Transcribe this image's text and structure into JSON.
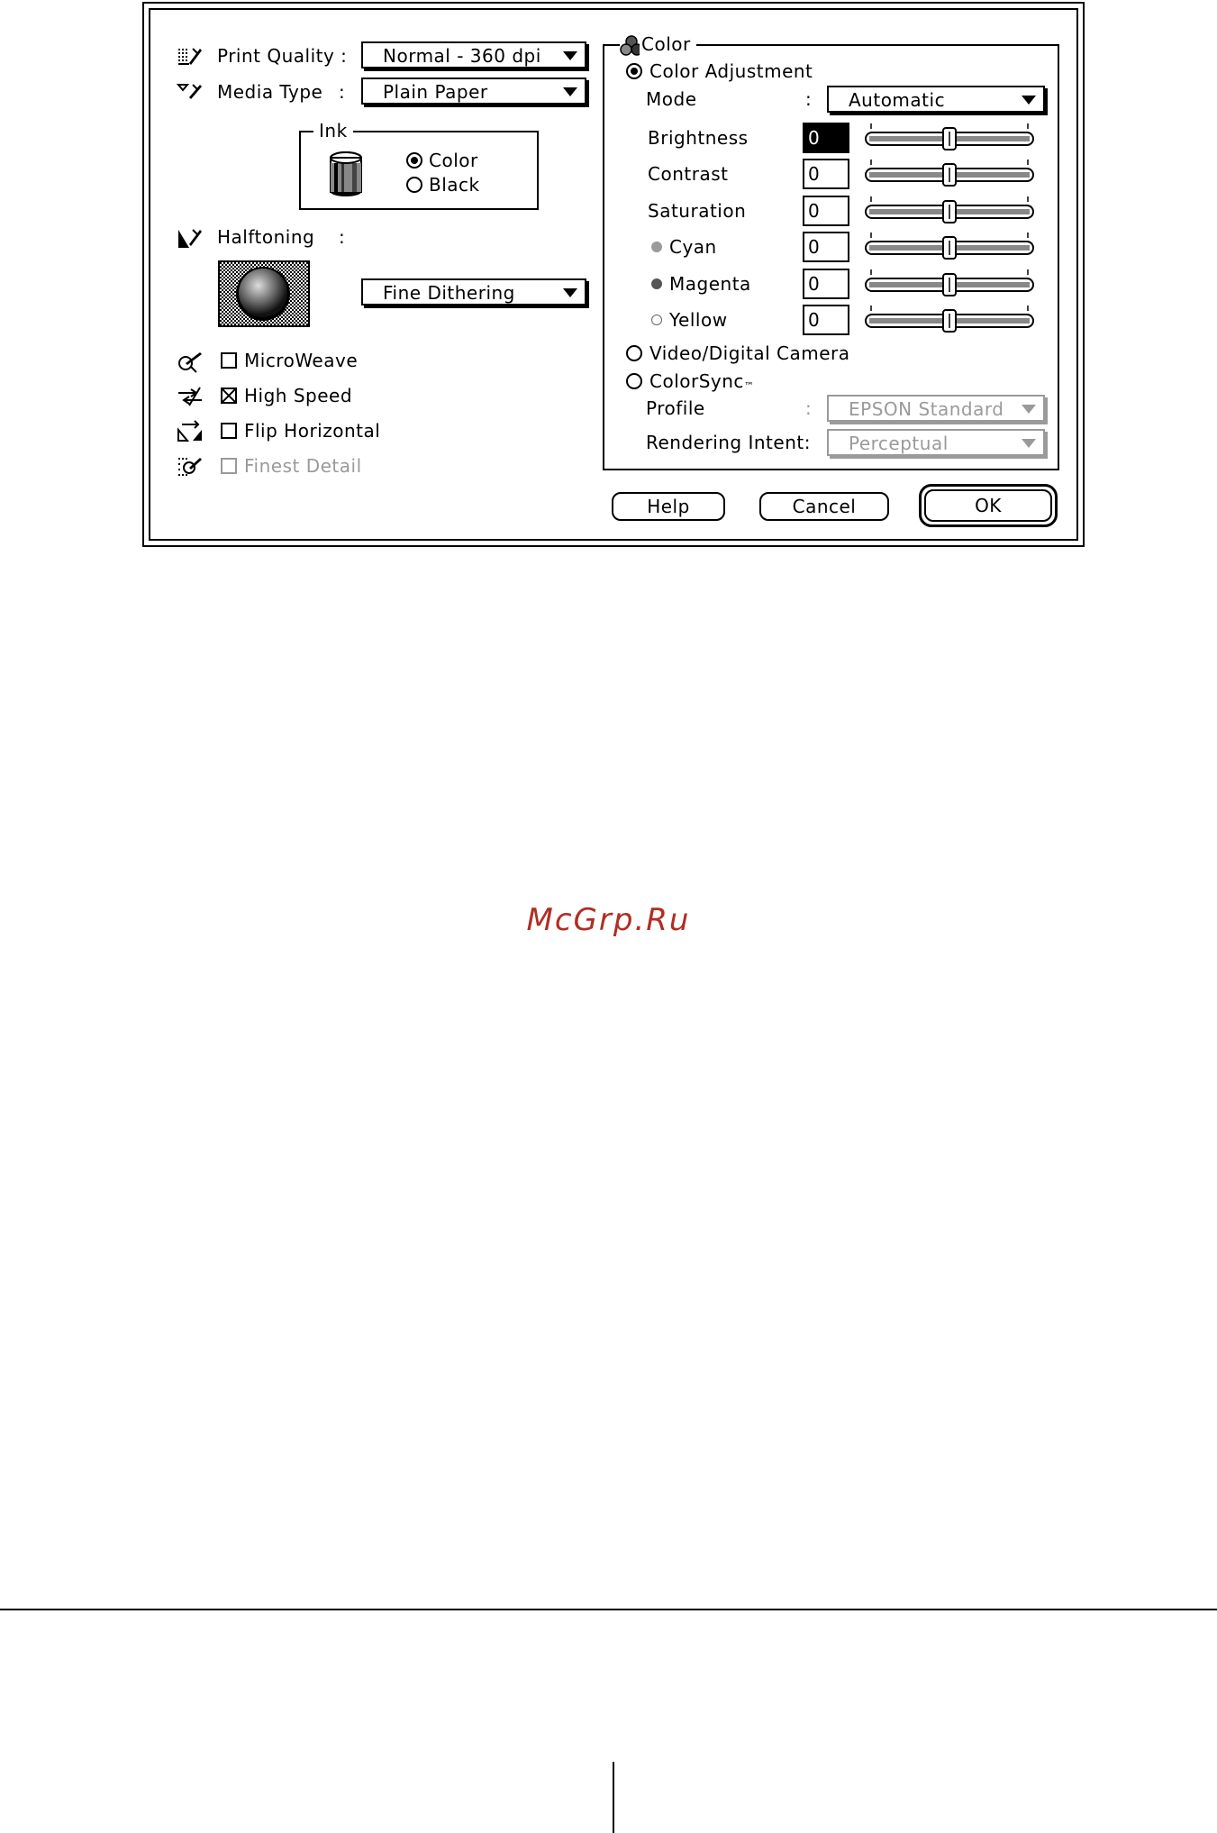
{
  "dialog": {
    "print_quality": {
      "label": "Print Quality :",
      "value": "Normal - 360 dpi",
      "icon": "print-quality-icon"
    },
    "media_type": {
      "label": "Media Type",
      "colon": ":",
      "value": "Plain Paper",
      "icon": "media-type-icon"
    },
    "ink": {
      "title": "Ink",
      "icon": "ink-cartridge-icon",
      "options": [
        {
          "label": "Color",
          "selected": true
        },
        {
          "label": "Black",
          "selected": false
        }
      ]
    },
    "halftoning": {
      "label": "Halftoning",
      "colon": ":",
      "value": "Fine Dithering",
      "icon": "halftoning-icon"
    },
    "checkboxes": [
      {
        "label": "MicroWeave",
        "checked": false,
        "enabled": true,
        "icon": "microweave-icon"
      },
      {
        "label": "High Speed",
        "checked": true,
        "enabled": true,
        "icon": "high-speed-icon"
      },
      {
        "label": "Flip Horizontal",
        "checked": false,
        "enabled": true,
        "icon": "flip-horizontal-icon"
      },
      {
        "label": "Finest Detail",
        "checked": false,
        "enabled": false,
        "icon": "finest-detail-icon"
      }
    ],
    "color": {
      "title": "Color",
      "color_adjustment": {
        "label": "Color Adjustment",
        "selected": true
      },
      "mode": {
        "label": "Mode",
        "colon": ":",
        "value": "Automatic"
      },
      "sliders": [
        {
          "label": "Brightness",
          "value": "0",
          "dot": ""
        },
        {
          "label": "Contrast",
          "value": "0",
          "dot": ""
        },
        {
          "label": "Saturation",
          "value": "0",
          "dot": ""
        },
        {
          "label": "Cyan",
          "value": "0",
          "dot": "#9a9a9a"
        },
        {
          "label": "Magenta",
          "value": "0",
          "dot": "#555555"
        },
        {
          "label": "Yellow",
          "value": "0",
          "dot": "#ffffff"
        }
      ],
      "video_camera": {
        "label": "Video/Digital Camera",
        "selected": false
      },
      "colorsync": {
        "label": "ColorSync",
        "superscript": "™",
        "selected": false
      },
      "profile": {
        "label": "Profile",
        "colon": ":",
        "value": "EPSON Standard"
      },
      "rendering_intent": {
        "label": "Rendering Intent:",
        "value": "Perceptual"
      }
    },
    "buttons": {
      "help": "Help",
      "cancel": "Cancel",
      "ok": "OK"
    }
  },
  "watermark": "McGrp.Ru"
}
